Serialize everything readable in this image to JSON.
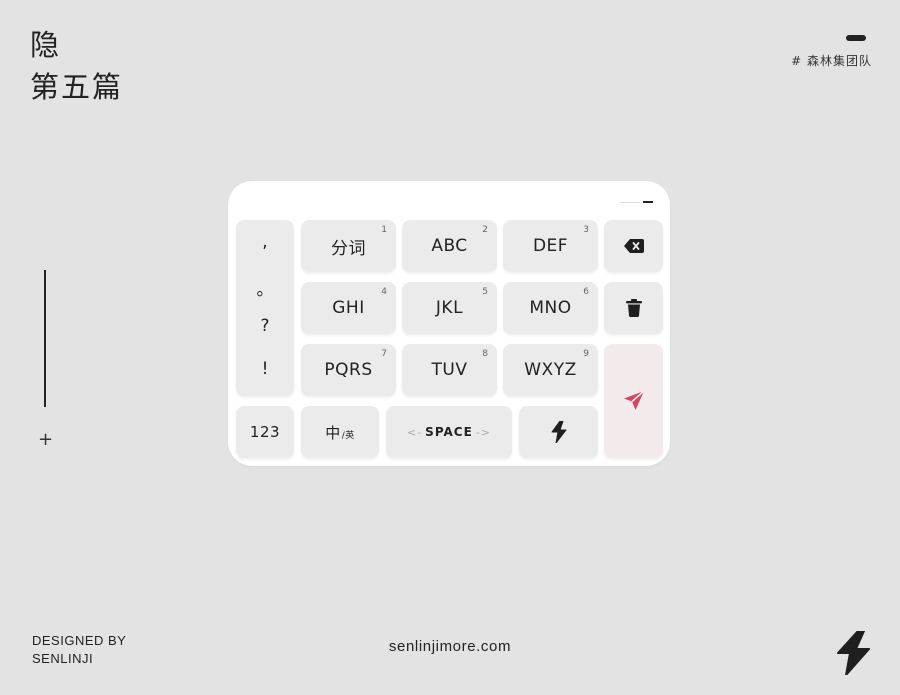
{
  "header": {
    "title_line1": "隐",
    "title_line2": "第五篇",
    "brand_tag": "# 森林集团队"
  },
  "keyboard": {
    "punctuation": [
      ",",
      "。",
      "?",
      "!"
    ],
    "rows": [
      [
        {
          "label": "分词",
          "num": "1"
        },
        {
          "label": "ABC",
          "num": "2"
        },
        {
          "label": "DEF",
          "num": "3"
        }
      ],
      [
        {
          "label": "GHI",
          "num": "4"
        },
        {
          "label": "JKL",
          "num": "5"
        },
        {
          "label": "MNO",
          "num": "6"
        }
      ],
      [
        {
          "label": "PQRS",
          "num": "7"
        },
        {
          "label": "TUV",
          "num": "8"
        },
        {
          "label": "WXYZ",
          "num": "9"
        }
      ]
    ],
    "numbers_label": "123",
    "lang_main": "中",
    "lang_sub": "/英",
    "space_left": "<-",
    "space_label": "SPACE",
    "space_right": "->",
    "icons": {
      "backspace": "backspace-icon",
      "delete": "trash-icon",
      "send": "send-icon",
      "lightning": "lightning-icon"
    },
    "send_color": "#d6455f"
  },
  "footer": {
    "designed_by_line1": "DESIGNED BY",
    "designed_by_line2": "SENLINJI",
    "website": "senlinjimore.com"
  }
}
